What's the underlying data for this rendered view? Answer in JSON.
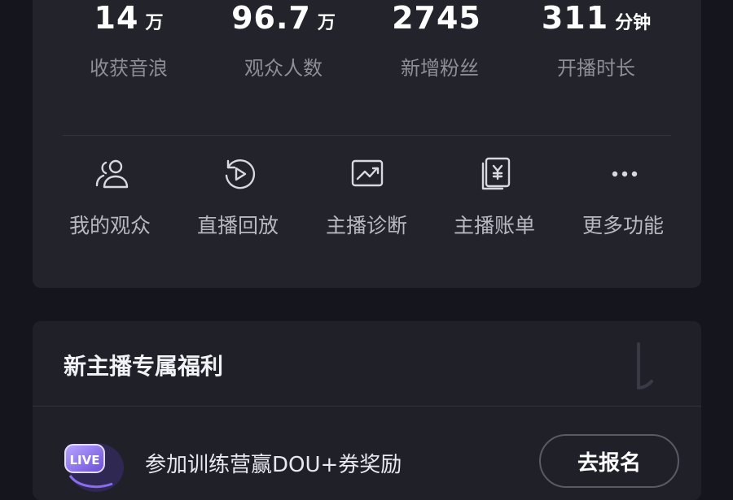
{
  "stats": [
    {
      "value": "14",
      "unit": "万",
      "label": "收获音浪"
    },
    {
      "value": "96.7",
      "unit": "万",
      "label": "观众人数"
    },
    {
      "value": "2745",
      "unit": "",
      "label": "新增粉丝"
    },
    {
      "value": "311",
      "unit": "分钟",
      "label": "开播时长"
    }
  ],
  "tools": [
    {
      "label": "我的观众",
      "icon": "audience-icon"
    },
    {
      "label": "直播回放",
      "icon": "replay-icon"
    },
    {
      "label": "主播诊断",
      "icon": "diagnosis-icon"
    },
    {
      "label": "主播账单",
      "icon": "bill-icon"
    },
    {
      "label": "更多功能",
      "icon": "more-icon"
    }
  ],
  "benefit": {
    "title": "新主播专属福利",
    "task_text": "参加训练营赢DOU+券奖励",
    "signup_label": "去报名",
    "badge_text": "LIVE"
  },
  "colors": {
    "background": "#15151d",
    "card": "#23232c",
    "label_gray": "#8e8e98",
    "badge_purple": "#8a6cf0"
  }
}
